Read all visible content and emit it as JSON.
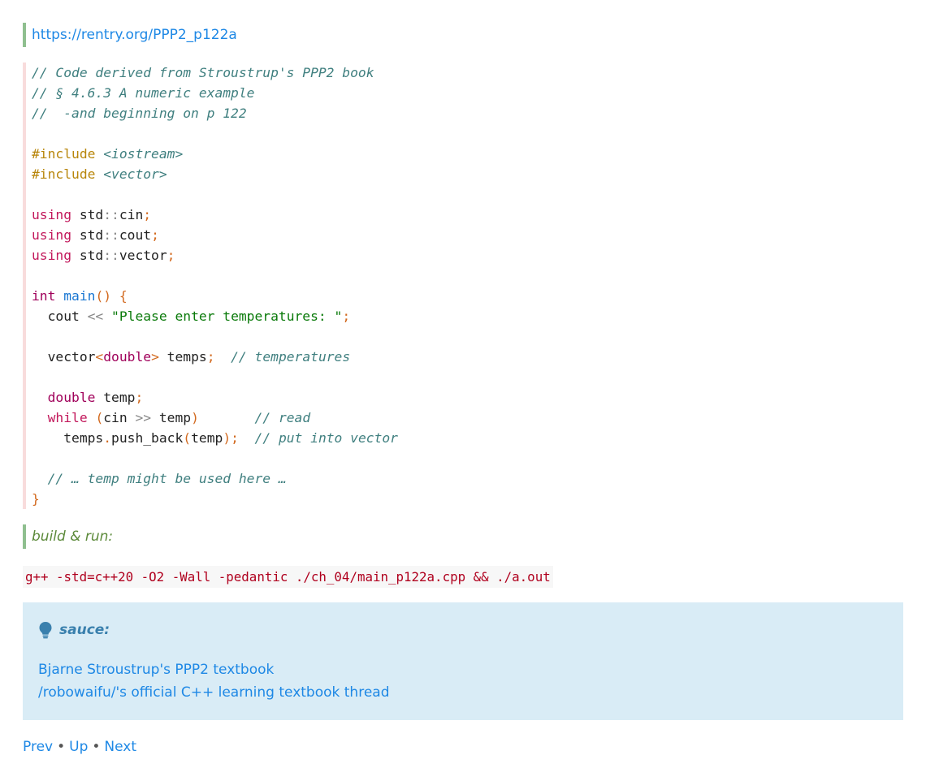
{
  "link": {
    "url_text": "https://rentry.org/PPP2_p122a"
  },
  "code": {
    "lines": [
      [
        {
          "c": "comment",
          "t": "// Code derived from Stroustrup's PPP2 book"
        }
      ],
      [
        {
          "c": "comment",
          "t": "// § 4.6.3 A numeric example"
        }
      ],
      [
        {
          "c": "comment",
          "t": "//  -and beginning on p 122"
        }
      ],
      [],
      [
        {
          "c": "pp",
          "t": "#include"
        },
        {
          "c": "text",
          "t": " "
        },
        {
          "c": "ppfile",
          "t": "<iostream>"
        }
      ],
      [
        {
          "c": "pp",
          "t": "#include"
        },
        {
          "c": "text",
          "t": " "
        },
        {
          "c": "ppfile",
          "t": "<vector>"
        }
      ],
      [],
      [
        {
          "c": "keyword",
          "t": "using"
        },
        {
          "c": "text",
          "t": " std"
        },
        {
          "c": "op",
          "t": "::"
        },
        {
          "c": "text",
          "t": "cin"
        },
        {
          "c": "punct",
          "t": ";"
        }
      ],
      [
        {
          "c": "keyword",
          "t": "using"
        },
        {
          "c": "text",
          "t": " std"
        },
        {
          "c": "op",
          "t": "::"
        },
        {
          "c": "text",
          "t": "cout"
        },
        {
          "c": "punct",
          "t": ";"
        }
      ],
      [
        {
          "c": "keyword",
          "t": "using"
        },
        {
          "c": "text",
          "t": " std"
        },
        {
          "c": "op",
          "t": "::"
        },
        {
          "c": "text",
          "t": "vector"
        },
        {
          "c": "punct",
          "t": ";"
        }
      ],
      [],
      [
        {
          "c": "type",
          "t": "int"
        },
        {
          "c": "text",
          "t": " "
        },
        {
          "c": "func",
          "t": "main"
        },
        {
          "c": "punct",
          "t": "()"
        },
        {
          "c": "text",
          "t": " "
        },
        {
          "c": "punct",
          "t": "{"
        }
      ],
      [
        {
          "c": "text",
          "t": "  cout "
        },
        {
          "c": "op",
          "t": "<<"
        },
        {
          "c": "text",
          "t": " "
        },
        {
          "c": "string",
          "t": "\"Please enter temperatures: \""
        },
        {
          "c": "punct",
          "t": ";"
        }
      ],
      [],
      [
        {
          "c": "text",
          "t": "  vector"
        },
        {
          "c": "punct",
          "t": "<"
        },
        {
          "c": "type",
          "t": "double"
        },
        {
          "c": "punct",
          "t": ">"
        },
        {
          "c": "text",
          "t": " temps"
        },
        {
          "c": "punct",
          "t": ";"
        },
        {
          "c": "text",
          "t": "  "
        },
        {
          "c": "comment",
          "t": "// temperatures"
        }
      ],
      [],
      [
        {
          "c": "text",
          "t": "  "
        },
        {
          "c": "type",
          "t": "double"
        },
        {
          "c": "text",
          "t": " temp"
        },
        {
          "c": "punct",
          "t": ";"
        }
      ],
      [
        {
          "c": "text",
          "t": "  "
        },
        {
          "c": "keyword",
          "t": "while"
        },
        {
          "c": "text",
          "t": " "
        },
        {
          "c": "punct",
          "t": "("
        },
        {
          "c": "text",
          "t": "cin "
        },
        {
          "c": "op",
          "t": ">>"
        },
        {
          "c": "text",
          "t": " temp"
        },
        {
          "c": "punct",
          "t": ")"
        },
        {
          "c": "text",
          "t": "       "
        },
        {
          "c": "comment",
          "t": "// read"
        }
      ],
      [
        {
          "c": "text",
          "t": "    temps"
        },
        {
          "c": "punct",
          "t": "."
        },
        {
          "c": "text",
          "t": "push_back"
        },
        {
          "c": "punct",
          "t": "("
        },
        {
          "c": "text",
          "t": "temp"
        },
        {
          "c": "punct",
          "t": ");"
        },
        {
          "c": "text",
          "t": "  "
        },
        {
          "c": "comment",
          "t": "// put into vector"
        }
      ],
      [],
      [
        {
          "c": "text",
          "t": "  "
        },
        {
          "c": "comment",
          "t": "// … temp might be used here …"
        }
      ],
      [
        {
          "c": "punct",
          "t": "}"
        }
      ]
    ]
  },
  "build_note": "build & run:",
  "command": "g++ -std=c++20 -O2 -Wall -pedantic ./ch_04/main_p122a.cpp && ./a.out",
  "tip": {
    "icon": "lightbulb-icon",
    "title": "sauce:",
    "links": [
      "Bjarne Stroustrup's PPP2 textbook",
      "/robowaifu/'s official C++ learning textbook thread"
    ]
  },
  "nav": {
    "prev": "Prev",
    "up": "Up",
    "next": "Next",
    "separator": "•"
  },
  "colors": {
    "link": "#1e88e5",
    "quote_border": "#8fbf8f",
    "tip_background": "#d9ecf6",
    "command": "#b0001e"
  }
}
